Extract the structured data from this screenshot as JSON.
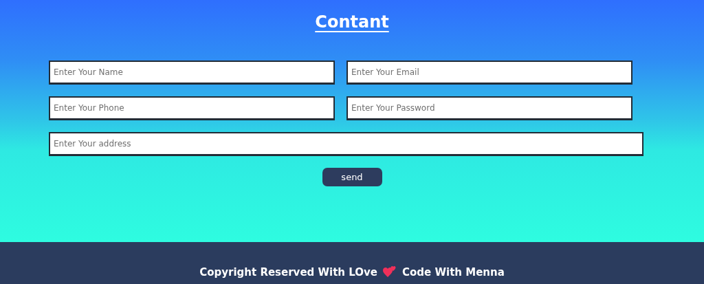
{
  "heading": "Contant",
  "fields": [
    {
      "placeholder": "Enter Your Name",
      "kind": "half"
    },
    {
      "placeholder": "Enter Your Email",
      "kind": "half"
    },
    {
      "placeholder": "Enter Your Phone",
      "kind": "half"
    },
    {
      "placeholder": "Enter Your Password",
      "kind": "half"
    },
    {
      "placeholder": "Enter Your address",
      "kind": "full"
    }
  ],
  "button": "send",
  "footer": {
    "before": "Copyright Reserved With LOve",
    "after": "Code With Menna"
  }
}
